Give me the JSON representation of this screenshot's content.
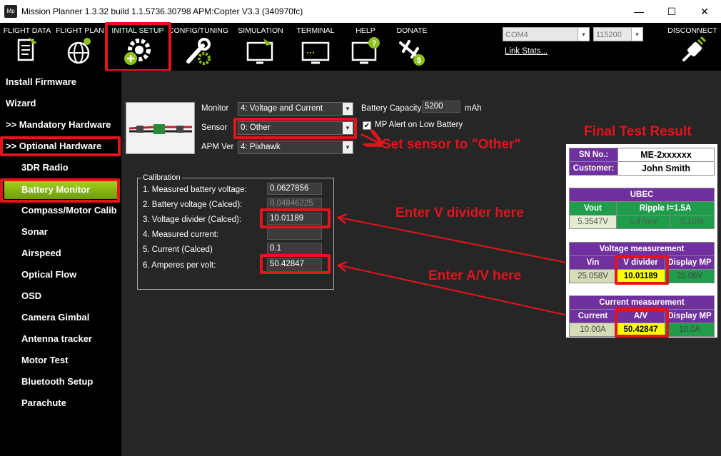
{
  "window": {
    "title": "Mission Planner 1.3.32 build 1.1.5736.30798 APM:Copter V3.3 (340970fc)",
    "app_icon": "Mp",
    "minimize": "—",
    "maximize": "☐",
    "close": "✕"
  },
  "toolbar": {
    "flight_data": "FLIGHT DATA",
    "flight_plan": "FLIGHT PLAN",
    "initial_setup": "INITIAL SETUP",
    "config_tuning": "CONFIG/TUNING",
    "simulation": "SIMULATION",
    "terminal": "TERMINAL",
    "help": "HELP",
    "donate": "DONATE",
    "disconnect": "DISCONNECT",
    "com_port": "COM4",
    "baud": "115200",
    "link_stats": "Link Stats..."
  },
  "sidebar": {
    "items": [
      {
        "label": "Install Firmware"
      },
      {
        "label": "Wizard"
      },
      {
        "label": ">> Mandatory Hardware"
      },
      {
        "label": ">> Optional Hardware"
      },
      {
        "label": "3DR Radio"
      },
      {
        "label": "Battery Monitor"
      },
      {
        "label": "Compass/Motor Calib"
      },
      {
        "label": "Sonar"
      },
      {
        "label": "Airspeed"
      },
      {
        "label": "Optical Flow"
      },
      {
        "label": "OSD"
      },
      {
        "label": "Camera Gimbal"
      },
      {
        "label": "Antenna tracker"
      },
      {
        "label": "Motor Test"
      },
      {
        "label": "Bluetooth Setup"
      },
      {
        "label": "Parachute"
      }
    ]
  },
  "battery": {
    "monitor_label": "Monitor",
    "monitor_value": "4: Voltage and Current",
    "sensor_label": "Sensor",
    "sensor_value": "0: Other",
    "apm_label": "APM Ver",
    "apm_value": "4: Pixhawk",
    "capacity_label": "Battery Capacity",
    "capacity_value": "5200",
    "capacity_unit": "mAh",
    "alert_label": "MP Alert on Low Battery",
    "alert_checked": "✔"
  },
  "calibration": {
    "title": "Calibration",
    "rows": [
      {
        "label": "1. Measured battery voltage:",
        "value": "0.0627856"
      },
      {
        "label": "2. Battery voltage (Calced):",
        "value": "0.04846225"
      },
      {
        "label": "3. Voltage divider (Calced):",
        "value": "10.01189"
      },
      {
        "label": "4. Measured current:",
        "value": ""
      },
      {
        "label": "5. Current (Calced)",
        "value": "0.1"
      },
      {
        "label": "6. Amperes per volt:",
        "value": "50.42847"
      }
    ]
  },
  "annotations": {
    "set_sensor": "Set sensor to \"Other\"",
    "enter_v": "Enter V divider here",
    "enter_av": "Enter A/V here",
    "final_title": "Final Test Result"
  },
  "result": {
    "sn_label": "SN No.:",
    "sn_value": "ME-2xxxxxx",
    "customer_label": "Customer:",
    "customer_value": "John Smith",
    "ubec_title": "UBEC",
    "vout": "Vout",
    "ripple": "Ripple I=1.5A",
    "vout_value": "5.3547V",
    "ripple_value1": "5.47mV",
    "ripple_value2": "0.10%",
    "voltage_title": "Voltage measurement",
    "vin": "Vin",
    "vdiv": "V divider",
    "display_mp": "Display MP",
    "vin_value": "25.058V",
    "vdiv_value": "10.01189",
    "vmp_value": "25.06V",
    "current_title": "Current measurement",
    "current": "Current",
    "av": "A/V",
    "display_mp2": "Display MP",
    "current_value": "10.00A",
    "av_value": "50.42847",
    "cmp_value": "10.0A"
  },
  "colors": {
    "accent_red": "#e4141c",
    "active_green": "#8cc21a",
    "table_purple": "#7030a0",
    "table_green": "#1e9e4a",
    "highlight_yellow": "#ffff00"
  }
}
